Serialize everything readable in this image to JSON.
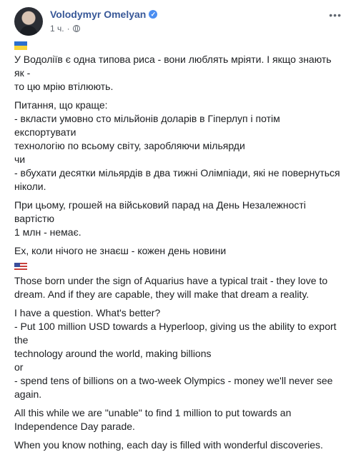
{
  "post": {
    "author": "Volodymyr Omelyan",
    "timestamp": "1 ч.",
    "visibility_icon": "globe-icon",
    "verified_icon": "verified-badge-icon",
    "more_icon": "more-options-icon",
    "paragraphs_ua": [
      "У Водоліїв є одна типова риса - вони люблять мріяти. І якщо знають як -\nто цю мрію втілюють.",
      "Питання, що краще:\n- вкласти умовно сто мільйонів доларів в Гіперлуп і потім експортувати\nтехнологію по всьому світу, заробляючи мільярди\nчи\n- вбухати десятки мільярдів в два тижні Олімпіади, які не повернуться\nніколи.",
      "При цьому, грошей на військовий парад на День Незалежності вартістю\n1 млн - немає.",
      "Ех, коли нічого не знаєш - кожен день новини"
    ],
    "paragraphs_en": [
      "Those born under the sign of Aquarius have a typical trait - they love to\ndream. And if they are capable, they will make that dream a reality.",
      "I have a question. What's better?\n- Put 100 million USD towards a Hyperloop, giving us the ability to export the\ntechnology around the world, making billions\nor\n- spend tens of billions on a two-week Olympics - money we'll never see\nagain.",
      "All this while we are \"unable\" to find 1 million to put towards an\nIndependence Day parade.",
      "When you know nothing, each day is filled with wonderful discoveries."
    ],
    "flag_ua_icon": "ukraine-flag-icon",
    "flag_us_icon": "usa-flag-icon"
  }
}
